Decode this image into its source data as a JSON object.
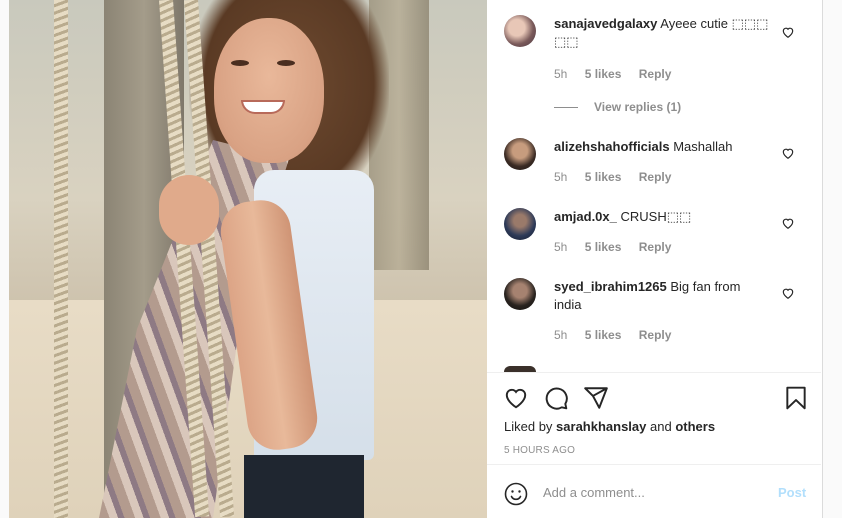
{
  "comments": [
    {
      "user": "sanajavedgalaxy",
      "text": "Ayeee cutie ⬚⬚⬚ ⬚⬚",
      "time": "5h",
      "likes": "5 likes",
      "reply": "Reply",
      "view_replies": "View replies (1)",
      "avatar_icon": "user-avatar-icon"
    },
    {
      "user": "alizehshahofficials",
      "text": "Mashallah",
      "time": "5h",
      "likes": "5 likes",
      "reply": "Reply",
      "avatar_icon": "user-avatar-icon"
    },
    {
      "user": "amjad.0x_",
      "text": "CRUSH⬚⬚",
      "time": "5h",
      "likes": "5 likes",
      "reply": "Reply",
      "avatar_icon": "user-avatar-icon"
    },
    {
      "user": "syed_ibrahim1265",
      "text": "Big fan from india",
      "time": "5h",
      "likes": "5 likes",
      "reply": "Reply",
      "avatar_icon": "user-avatar-icon"
    }
  ],
  "actions": {
    "liked_prefix": "Liked by",
    "liked_user": "sarahkhanslay",
    "liked_and": "and",
    "liked_others": "others",
    "timestamp": "5 HOURS AGO",
    "icons": [
      "heart-icon",
      "comment-icon",
      "share-icon",
      "bookmark-icon"
    ]
  },
  "add_comment": {
    "placeholder": "Add a comment...",
    "post_label": "Post",
    "emoji_icon": "emoji-icon"
  },
  "colors": {
    "text": "#262626",
    "muted": "#8e8e8e",
    "post_disabled": "#b2dffc",
    "border": "#dbdbdb"
  }
}
